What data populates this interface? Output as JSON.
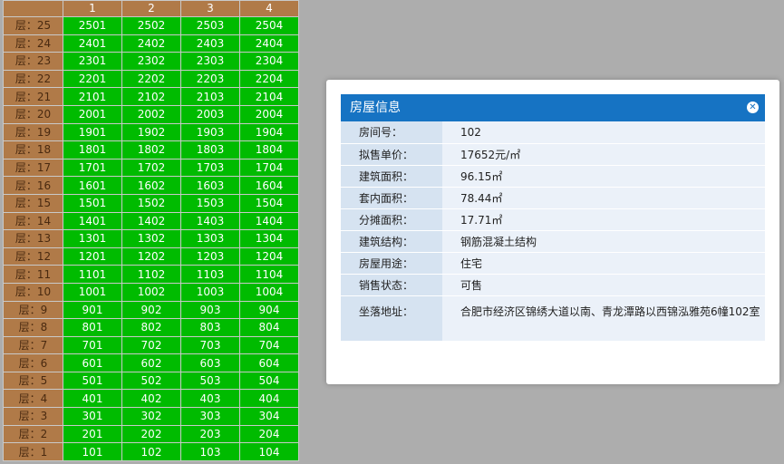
{
  "grid": {
    "columns": [
      "",
      "1",
      "2",
      "3",
      "4"
    ],
    "rows": [
      {
        "floor": "层：25",
        "units": [
          "2501",
          "2502",
          "2503",
          "2504"
        ]
      },
      {
        "floor": "层：24",
        "units": [
          "2401",
          "2402",
          "2403",
          "2404"
        ]
      },
      {
        "floor": "层：23",
        "units": [
          "2301",
          "2302",
          "2303",
          "2304"
        ]
      },
      {
        "floor": "层：22",
        "units": [
          "2201",
          "2202",
          "2203",
          "2204"
        ]
      },
      {
        "floor": "层：21",
        "units": [
          "2101",
          "2102",
          "2103",
          "2104"
        ]
      },
      {
        "floor": "层：20",
        "units": [
          "2001",
          "2002",
          "2003",
          "2004"
        ]
      },
      {
        "floor": "层：19",
        "units": [
          "1901",
          "1902",
          "1903",
          "1904"
        ]
      },
      {
        "floor": "层：18",
        "units": [
          "1801",
          "1802",
          "1803",
          "1804"
        ]
      },
      {
        "floor": "层：17",
        "units": [
          "1701",
          "1702",
          "1703",
          "1704"
        ]
      },
      {
        "floor": "层：16",
        "units": [
          "1601",
          "1602",
          "1603",
          "1604"
        ]
      },
      {
        "floor": "层：15",
        "units": [
          "1501",
          "1502",
          "1503",
          "1504"
        ]
      },
      {
        "floor": "层：14",
        "units": [
          "1401",
          "1402",
          "1403",
          "1404"
        ]
      },
      {
        "floor": "层：13",
        "units": [
          "1301",
          "1302",
          "1303",
          "1304"
        ]
      },
      {
        "floor": "层：12",
        "units": [
          "1201",
          "1202",
          "1203",
          "1204"
        ]
      },
      {
        "floor": "层：11",
        "units": [
          "1101",
          "1102",
          "1103",
          "1104"
        ]
      },
      {
        "floor": "层：10",
        "units": [
          "1001",
          "1002",
          "1003",
          "1004"
        ]
      },
      {
        "floor": "层：9",
        "units": [
          "901",
          "902",
          "903",
          "904"
        ]
      },
      {
        "floor": "层：8",
        "units": [
          "801",
          "802",
          "803",
          "804"
        ]
      },
      {
        "floor": "层：7",
        "units": [
          "701",
          "702",
          "703",
          "704"
        ]
      },
      {
        "floor": "层：6",
        "units": [
          "601",
          "602",
          "603",
          "604"
        ]
      },
      {
        "floor": "层：5",
        "units": [
          "501",
          "502",
          "503",
          "504"
        ]
      },
      {
        "floor": "层：4",
        "units": [
          "401",
          "402",
          "403",
          "404"
        ]
      },
      {
        "floor": "层：3",
        "units": [
          "301",
          "302",
          "303",
          "304"
        ]
      },
      {
        "floor": "层：2",
        "units": [
          "201",
          "202",
          "203",
          "204"
        ]
      },
      {
        "floor": "层：1",
        "units": [
          "101",
          "102",
          "103",
          "104"
        ]
      }
    ],
    "colors": {
      "floor_bg": "#b07a48",
      "unit_bg": "#00bb00",
      "unit_text": "#ffffff"
    }
  },
  "popup": {
    "title": "房屋信息",
    "close_icon": "close-icon",
    "header_color": "#1673c3",
    "fields": [
      {
        "label": "房间号：",
        "value": "102"
      },
      {
        "label": "拟售单价：",
        "value": "17652元/㎡"
      },
      {
        "label": "建筑面积：",
        "value": "96.15㎡"
      },
      {
        "label": "套内面积：",
        "value": "78.44㎡"
      },
      {
        "label": "分摊面积：",
        "value": "17.71㎡"
      },
      {
        "label": "建筑结构：",
        "value": "钢筋混凝土结构"
      },
      {
        "label": "房屋用途：",
        "value": "住宅"
      },
      {
        "label": "销售状态：",
        "value": "可售"
      },
      {
        "label": "坐落地址：",
        "value": "合肥市经济区锦绣大道以南、青龙潭路以西锦泓雅苑6幢102室"
      }
    ]
  }
}
